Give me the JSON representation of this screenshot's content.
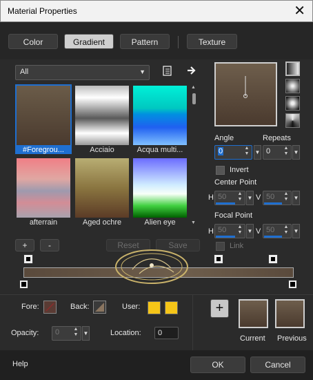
{
  "window": {
    "title": "Material Properties",
    "close": "✕"
  },
  "tabs": [
    {
      "label": "Color"
    },
    {
      "label": "Gradient"
    },
    {
      "label": "Pattern"
    },
    {
      "label": "Texture"
    }
  ],
  "category_select": {
    "value": "All"
  },
  "gradients": [
    {
      "label": "#Foregrou...",
      "selected": true
    },
    {
      "label": "Acciaio"
    },
    {
      "label": "Acqua multi..."
    },
    {
      "label": "afterrain"
    },
    {
      "label": "Aged ochre"
    },
    {
      "label": "Alien eye"
    }
  ],
  "list_buttons": {
    "add": "+",
    "remove": "-",
    "reset": "Reset",
    "save": "Save"
  },
  "angle": {
    "label": "Angle",
    "value": "0"
  },
  "repeats": {
    "label": "Repeats",
    "value": "0"
  },
  "invert": {
    "label": "Invert",
    "checked": false
  },
  "center_point": {
    "label": "Center Point",
    "h_label": "H",
    "h": "50",
    "v_label": "V",
    "v": "50"
  },
  "focal_point": {
    "label": "Focal Point",
    "h_label": "H",
    "h": "50",
    "v_label": "V",
    "v": "50"
  },
  "link": {
    "label": "Link",
    "checked": false
  },
  "stop_colors": {
    "fore_label": "Fore:",
    "back_label": "Back:",
    "user_label": "User:",
    "fore_color": "#5a3b34",
    "user_color": "#f5c518"
  },
  "opacity": {
    "label": "Opacity:",
    "value": "0"
  },
  "location": {
    "label": "Location:",
    "value": "0"
  },
  "material_preview": {
    "current_label": "Current",
    "previous_label": "Previous",
    "add": "+"
  },
  "footer": {
    "help": "Help",
    "ok": "OK",
    "cancel": "Cancel"
  },
  "colors": {
    "gradient_top": "#6e5e4c",
    "gradient_bottom": "#4a3a2e",
    "accent": "#1f6fd0"
  }
}
